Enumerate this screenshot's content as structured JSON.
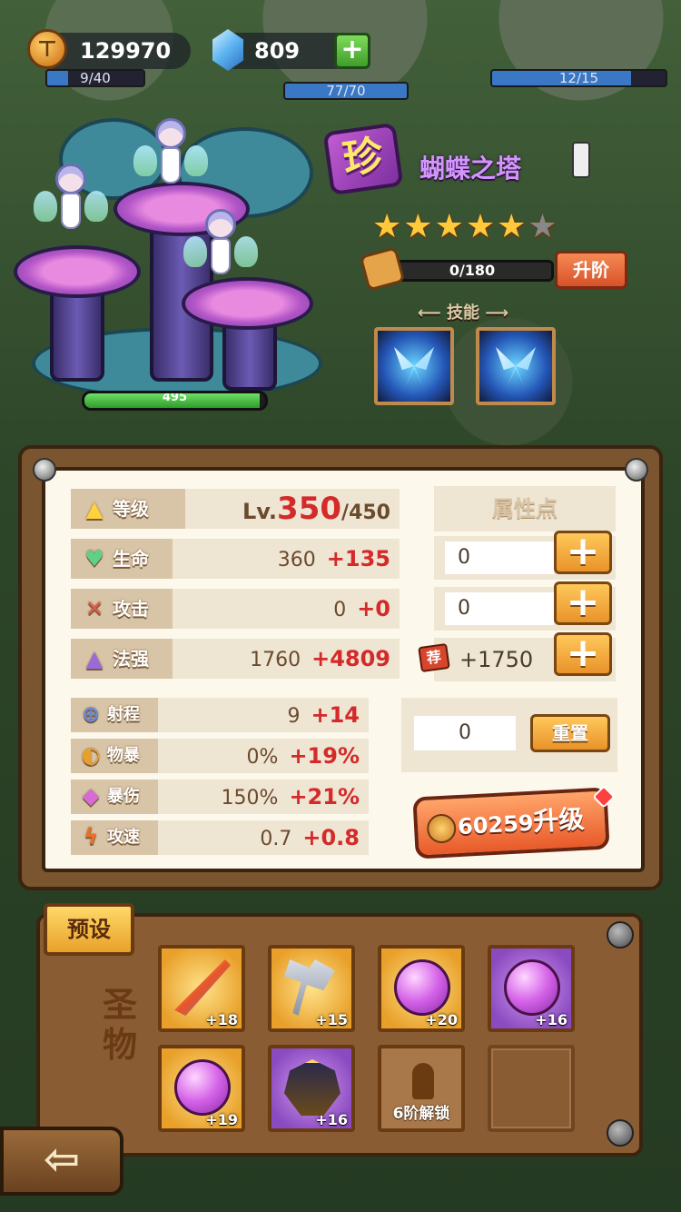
{
  "currency": {
    "gold": "129970",
    "gems": "809"
  },
  "buildings": {
    "left_progress": "9/40",
    "center_progress": "77/70",
    "right_progress": "12/15"
  },
  "tower": {
    "rarity": "珍",
    "name": "蝴蝶之塔",
    "stars_total": 6,
    "stars_filled": 5,
    "shard_progress": "0/180",
    "upgrade_tier_label": "升阶",
    "hp_value": "495",
    "hp_fraction": 0.97,
    "skills_label": "技能",
    "skills": [
      "butterfly-wing-skill",
      "butterfly-burst-skill"
    ]
  },
  "stats": {
    "level": {
      "label": "等级",
      "prefix": "Lv.",
      "current": "350",
      "max": "/450"
    },
    "hp": {
      "label": "生命",
      "base": "360",
      "bonus": "+135"
    },
    "attack": {
      "label": "攻击",
      "base": "0",
      "bonus": "+0"
    },
    "magic": {
      "label": "法强",
      "base": "1760",
      "bonus": "+4809"
    },
    "range": {
      "label": "射程",
      "base": "9",
      "bonus": "+14"
    },
    "crit_rate": {
      "label": "物暴",
      "base": "0%",
      "bonus": "+19%"
    },
    "crit_damage": {
      "label": "暴伤",
      "base": "150%",
      "bonus": "+21%"
    },
    "attack_speed": {
      "label": "攻速",
      "base": "0.7",
      "bonus": "+0.8"
    }
  },
  "attributes": {
    "header": "属性点",
    "hp_points": "0",
    "attack_points": "0",
    "recommend_badge": "荐",
    "magic_points": "+1750",
    "plus_symbol": "+",
    "remaining": "0",
    "reset_label": "重置"
  },
  "level_up": {
    "cost": "60259",
    "label": "升级"
  },
  "relics": {
    "preset_label": "预设",
    "section_label": "圣物",
    "slots": [
      {
        "icon": "flame-feather",
        "bonus": "+18",
        "tier": "gold"
      },
      {
        "icon": "battle-axe",
        "bonus": "+15",
        "tier": "gold"
      },
      {
        "icon": "purple-orb",
        "bonus": "+20",
        "tier": "gold"
      },
      {
        "icon": "purple-orb",
        "bonus": "+16",
        "tier": "purple"
      },
      {
        "icon": "purple-orb",
        "bonus": "+19",
        "tier": "gold"
      },
      {
        "icon": "dark-helm",
        "bonus": "+16",
        "tier": "purple"
      }
    ],
    "locked_label": "6阶解锁"
  },
  "back_symbol": "⇦",
  "colors": {
    "bonus_red": "#d42a2a",
    "panel_wood": "#7b5430",
    "panel_paper": "#fdf8ec",
    "button_orange": "#e8932a"
  }
}
